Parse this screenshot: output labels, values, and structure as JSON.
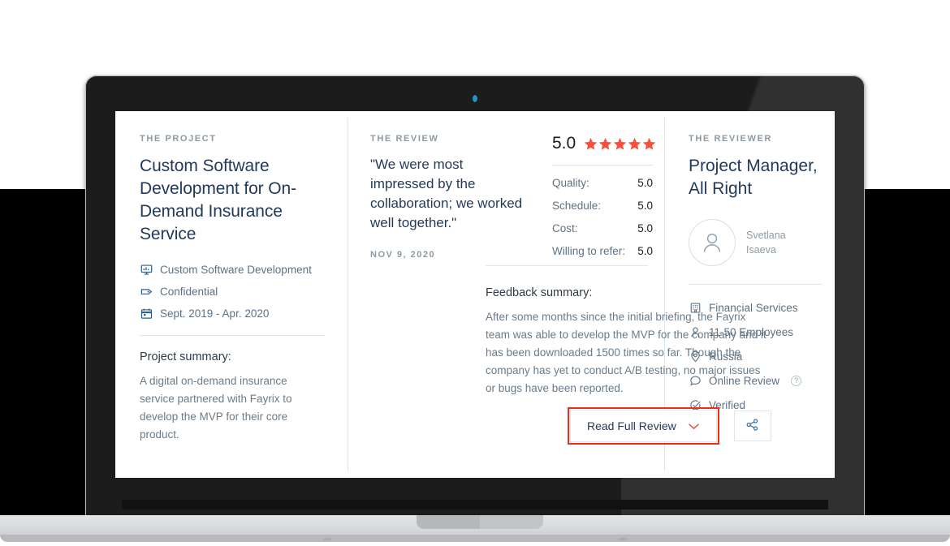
{
  "project": {
    "eyebrow": "THE PROJECT",
    "title": "Custom Software Development for On-Demand Insurance Service",
    "meta": [
      {
        "icon": "presentation-icon",
        "label": "Custom Software Development"
      },
      {
        "icon": "tag-icon",
        "label": "Confidential"
      },
      {
        "icon": "calendar-icon",
        "label": "Sept. 2019 - Apr. 2020"
      }
    ],
    "summary_heading": "Project summary:",
    "summary_text": "A digital on-demand insurance service partnered with Fayrix to develop the MVP for their core product."
  },
  "review": {
    "eyebrow": "THE REVIEW",
    "quote": "\"We were most impressed by the collaboration; we worked well together.\"",
    "date": "NOV 9, 2020",
    "feedback_heading": "Feedback summary:",
    "feedback_text": "After some months since the initial briefing, the Fayrix team was able to develop the MVP for the company and it has been downloaded 1500 times so far. Though the company has yet to conduct A/B testing, no major issues or bugs have been reported.",
    "read_full_label": "Read Full Review",
    "share_icon": "share-icon",
    "chevron_icon": "chevron-down-icon"
  },
  "rating": {
    "overall": "5.0",
    "stars": 5,
    "star_color": "#f9503b",
    "rows": [
      {
        "label": "Quality:",
        "value": "5.0"
      },
      {
        "label": "Schedule:",
        "value": "5.0"
      },
      {
        "label": "Cost:",
        "value": "5.0"
      },
      {
        "label": "Willing to refer:",
        "value": "5.0"
      }
    ]
  },
  "reviewer": {
    "eyebrow": "THE REVIEWER",
    "title": "Project Manager, All Right",
    "name": "Svetlana Isaeva",
    "avatar_icon": "person-avatar-icon",
    "facts": [
      {
        "icon": "building-icon",
        "label": "Financial Services"
      },
      {
        "icon": "person-icon",
        "label": "11-50 Employees"
      },
      {
        "icon": "location-pin-icon",
        "label": "Russia"
      },
      {
        "icon": "speech-bubble-icon",
        "label": "Online Review",
        "badge": "?"
      },
      {
        "icon": "check-circle-icon",
        "label": "Verified"
      }
    ]
  },
  "device": {
    "camera_icon": "webcam-dot-icon"
  }
}
